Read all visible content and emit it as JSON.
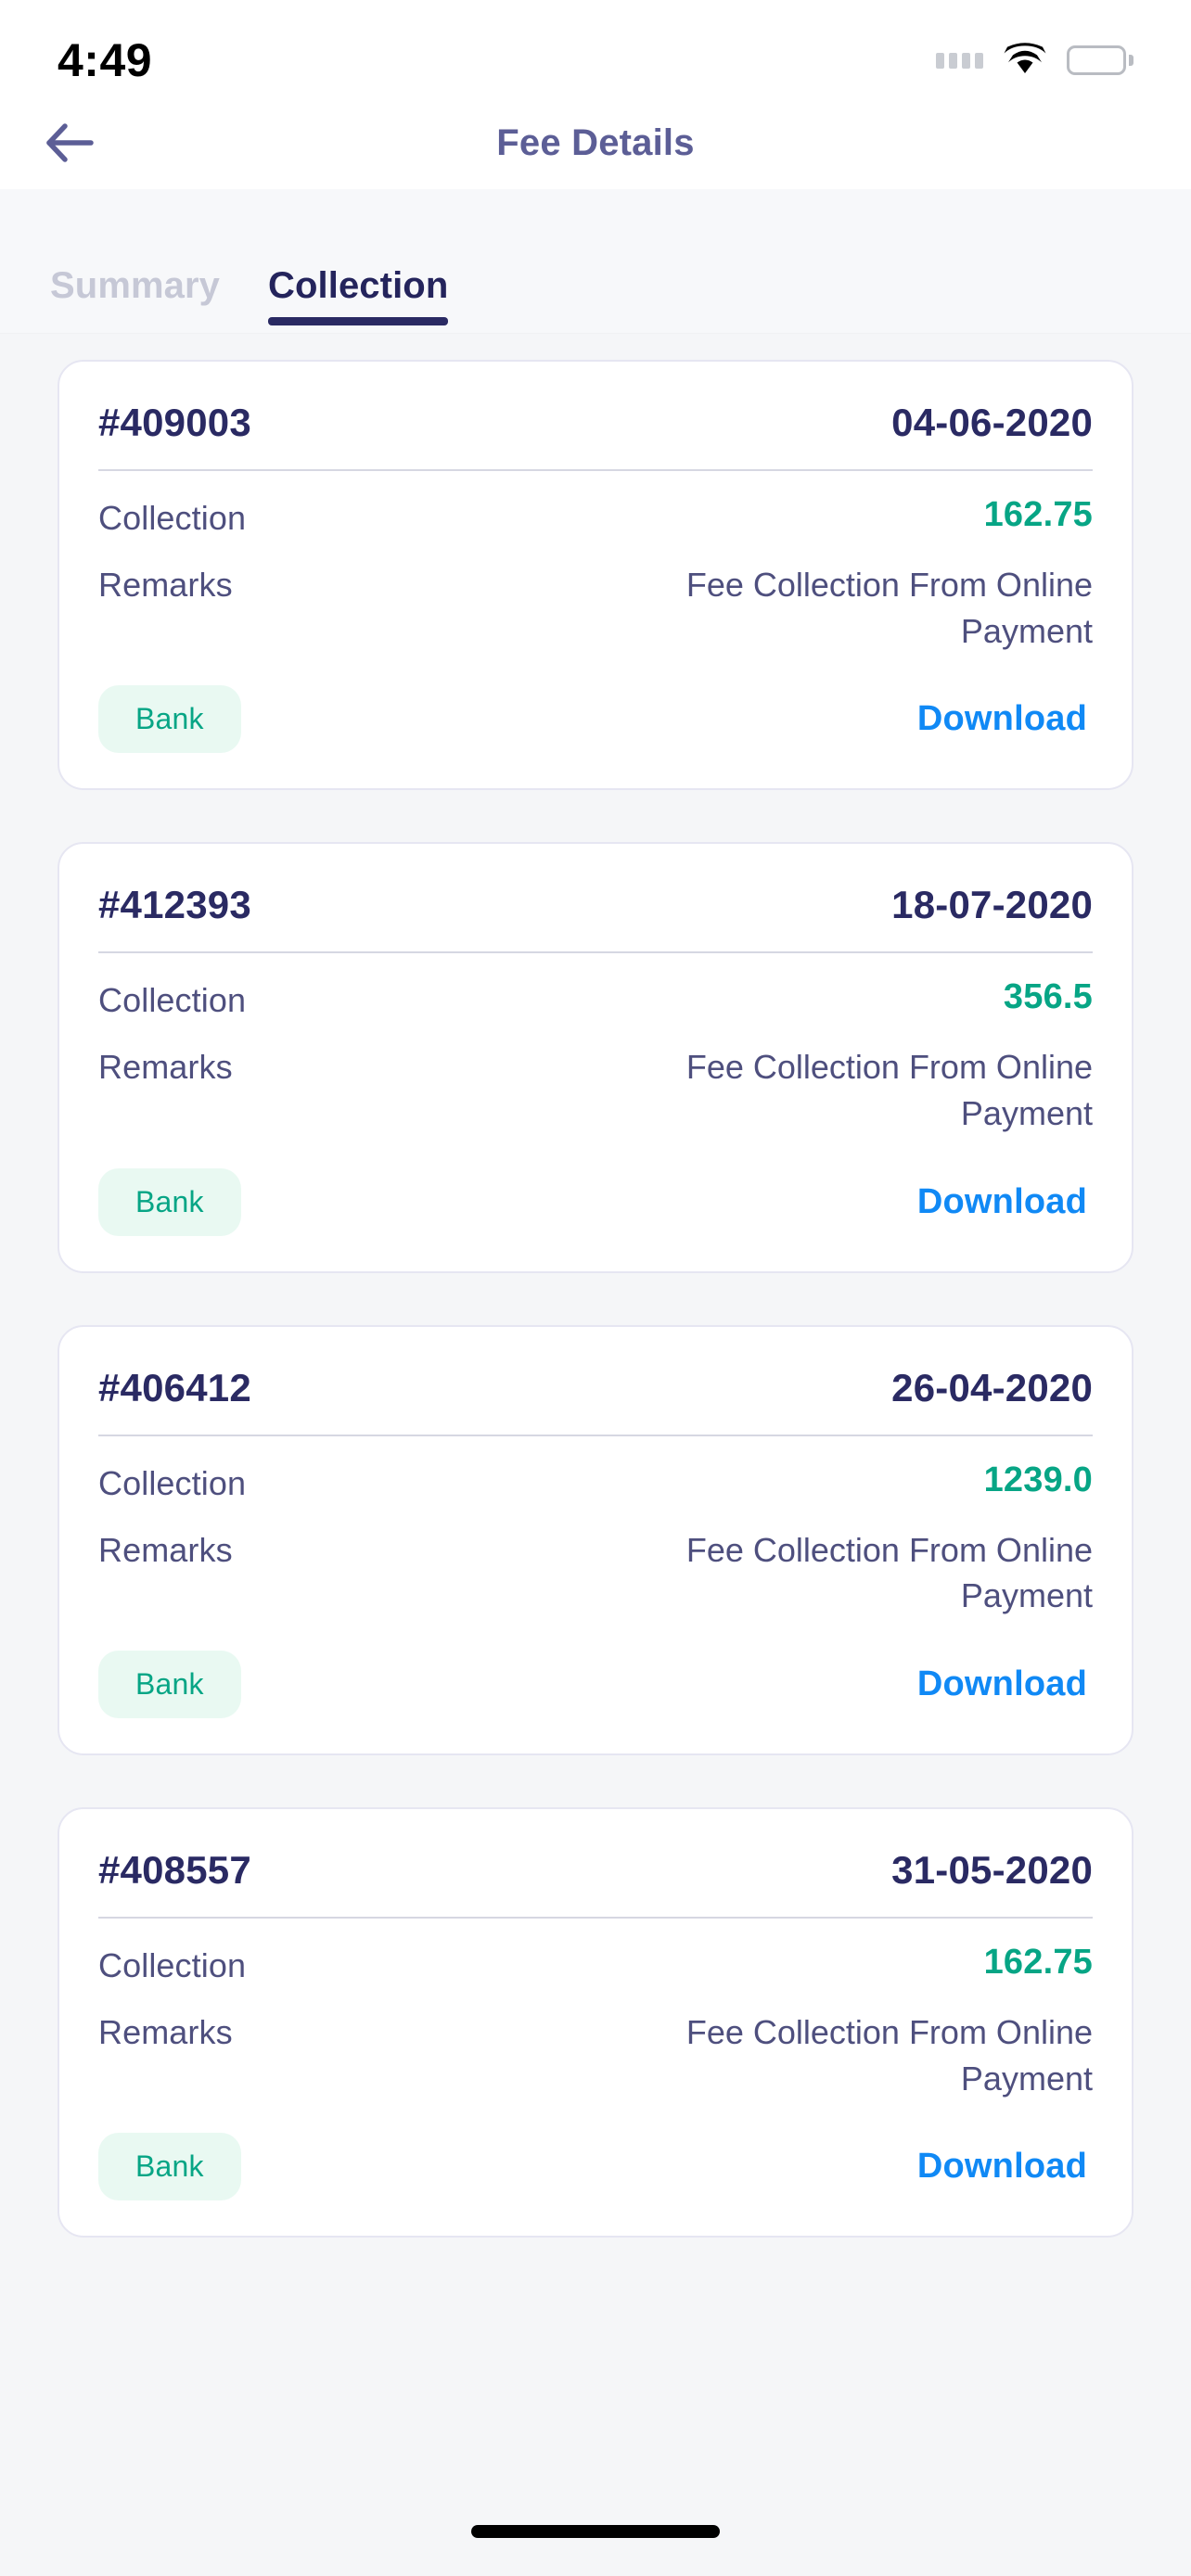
{
  "status_bar": {
    "time": "4:49",
    "signal_icon": "signal-dots-icon",
    "wifi_icon": "wifi-icon",
    "battery_icon": "battery-full-icon"
  },
  "header": {
    "back_icon": "back-arrow-icon",
    "title": "Fee Details",
    "title_color": "#5c5e96"
  },
  "tabs": {
    "active_index": 1,
    "items": [
      {
        "label": "Summary",
        "active": false
      },
      {
        "label": "Collection",
        "active": true
      }
    ],
    "active_color": "#24245c",
    "inactive_color": "#c6c8d6",
    "underline_color": "#2a2a63"
  },
  "labels": {
    "collection": "Collection",
    "remarks": "Remarks",
    "download": "Download"
  },
  "theme": {
    "amount_color": "#07a585",
    "badge_bg": "#e9f9f2",
    "badge_text": "#07a585",
    "link_color": "#1089f5",
    "card_border": "#e6e6f2",
    "page_bg": "#f5f6f8",
    "id_color": "#2a2a63"
  },
  "collections": [
    {
      "id": "#409003",
      "date": "04-06-2020",
      "collection_label": "Collection",
      "amount": "162.75",
      "remarks_label": "Remarks",
      "remarks": "Fee Collection From Online Payment",
      "mode": "Bank",
      "download": "Download"
    },
    {
      "id": "#412393",
      "date": "18-07-2020",
      "collection_label": "Collection",
      "amount": "356.5",
      "remarks_label": "Remarks",
      "remarks": "Fee Collection From Online Payment",
      "mode": "Bank",
      "download": "Download"
    },
    {
      "id": "#406412",
      "date": "26-04-2020",
      "collection_label": "Collection",
      "amount": "1239.0",
      "remarks_label": "Remarks",
      "remarks": "Fee Collection From Online Payment",
      "mode": "Bank",
      "download": "Download"
    },
    {
      "id": "#408557",
      "date": "31-05-2020",
      "collection_label": "Collection",
      "amount": "162.75",
      "remarks_label": "Remarks",
      "remarks": "Fee Collection From Online Payment",
      "mode": "Bank",
      "download": "Download"
    }
  ]
}
